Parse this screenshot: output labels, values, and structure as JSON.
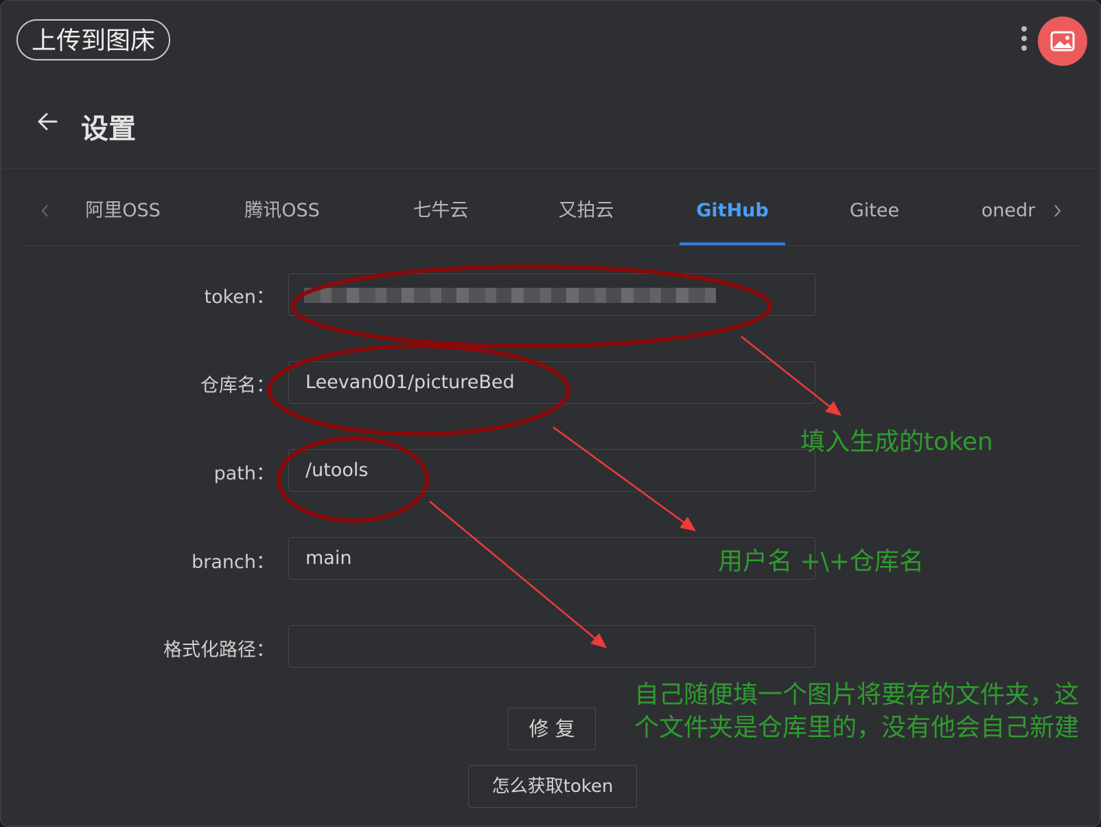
{
  "app": {
    "title": "上传到图床"
  },
  "header": {
    "title": "设置"
  },
  "tabs": [
    {
      "label": "阿里OSS",
      "active": false
    },
    {
      "label": "腾讯OSS",
      "active": false
    },
    {
      "label": "七牛云",
      "active": false
    },
    {
      "label": "又拍云",
      "active": false
    },
    {
      "label": "GitHub",
      "active": true
    },
    {
      "label": "Gitee",
      "active": false
    },
    {
      "label": "onedr",
      "active": false
    }
  ],
  "form": {
    "token": {
      "label": "token："
    },
    "repo": {
      "label": "仓库名：",
      "value": "Leevan001/pictureBed"
    },
    "path": {
      "label": "path：",
      "value": "/utools"
    },
    "branch": {
      "label": "branch：",
      "value": "main"
    },
    "format_path": {
      "label": "格式化路径：",
      "value": ""
    }
  },
  "buttons": {
    "repair": "修 复",
    "how_to_token": "怎么获取token"
  },
  "annotations": {
    "token_note": "填入生成的token",
    "repo_note": "用户名 +\\+仓库名",
    "path_note_line1": "自己随便填一个图片将要存的文件夹，这",
    "path_note_line2": "个文件夹是仓库里的，没有他会自己新建"
  },
  "colors": {
    "accent": "#4a9ff5",
    "annotation_text": "#2f9b2f",
    "annotation_circle": "#8b0a0a",
    "annotation_arrow": "#f03a3a",
    "avatar": "#ec5b5b"
  }
}
